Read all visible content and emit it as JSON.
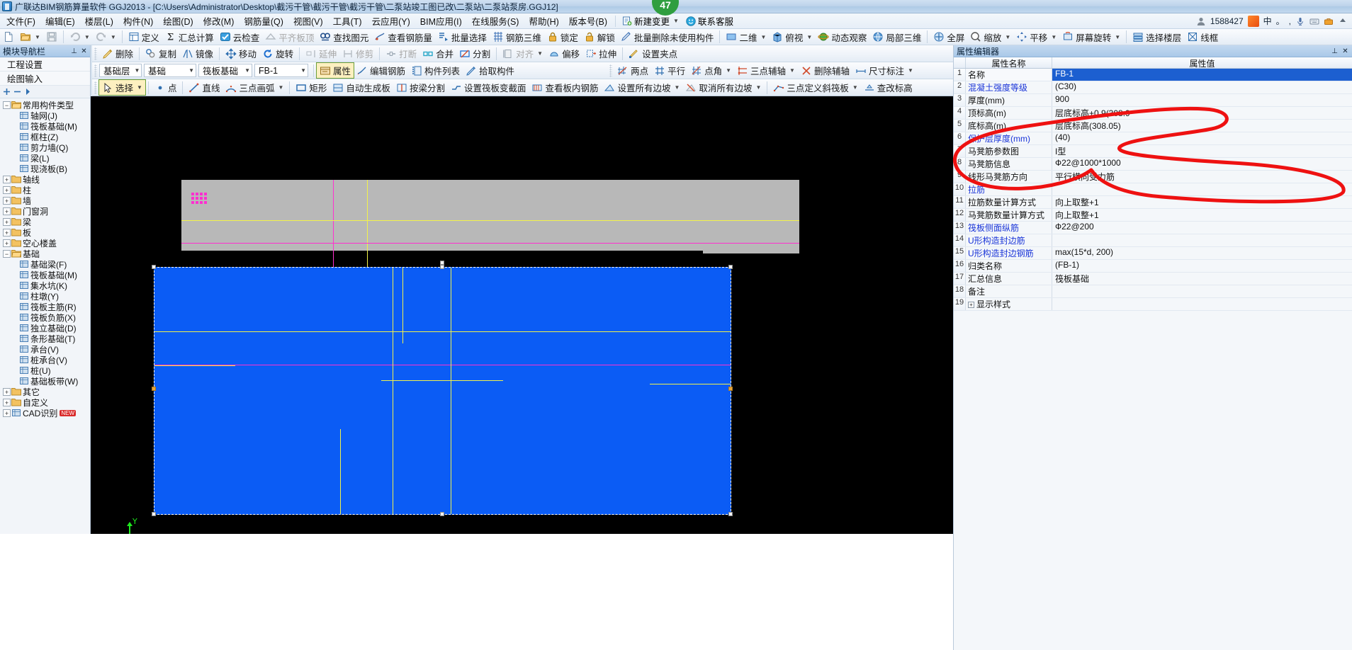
{
  "titlebar": {
    "title": "广联达BIM钢筋算量软件 GGJ2013 - [C:\\Users\\Administrator\\Desktop\\截污干管\\截污干管\\截污干管\\二泵站竣工图已改\\二泵站\\二泵站泵房.GGJ12]",
    "icon": "app-icon"
  },
  "menubar": {
    "items": [
      "文件(F)",
      "编辑(E)",
      "楼层(L)",
      "构件(N)",
      "绘图(D)",
      "修改(M)",
      "钢筋量(Q)",
      "视图(V)",
      "工具(T)",
      "云应用(Y)",
      "BIM应用(I)",
      "在线服务(S)",
      "帮助(H)",
      "版本号(B)"
    ],
    "new_change": "新建变更",
    "contact": "联系客服",
    "account": "1588427",
    "ime_items": [
      "中",
      "。",
      ",",
      "mic",
      "keyboard",
      "tool"
    ]
  },
  "toolbar1": {
    "items": [
      {
        "label": "",
        "icon": "new-file-icon",
        "disabled": false
      },
      {
        "label": "",
        "icon": "open-folder-icon",
        "disabled": false,
        "caret": true
      },
      {
        "label": "",
        "icon": "save-icon",
        "disabled": true
      },
      {
        "label": "",
        "icon": "undo-icon",
        "disabled": true,
        "caret": true
      },
      {
        "label": "",
        "icon": "redo-icon",
        "disabled": true,
        "caret": true
      },
      {
        "label": "定义",
        "icon": "define-icon"
      },
      {
        "label": "汇总计算",
        "icon": "sigma-icon"
      },
      {
        "label": "云检查",
        "icon": "cloud-check-icon"
      },
      {
        "label": "平齐板顶",
        "icon": "align-slab-top-icon",
        "disabled": true
      },
      {
        "label": "查找图元",
        "icon": "find-element-icon"
      },
      {
        "label": "查看钢筋量",
        "icon": "view-rebar-qty-icon"
      },
      {
        "label": "批量选择",
        "icon": "batch-select-icon"
      },
      {
        "label": "钢筋三维",
        "icon": "rebar-3d-icon"
      },
      {
        "label": "锁定",
        "icon": "lock-icon"
      },
      {
        "label": "解锁",
        "icon": "unlock-icon"
      },
      {
        "label": "批量删除未使用构件",
        "icon": "batch-delete-icon"
      },
      {
        "label": "二维",
        "icon": "view-2d-icon",
        "caret": true
      },
      {
        "label": "俯视",
        "icon": "top-view-icon",
        "caret": true
      },
      {
        "label": "动态观察",
        "icon": "orbit-icon"
      },
      {
        "label": "局部三维",
        "icon": "partial-3d-icon"
      },
      {
        "label": "全屏",
        "icon": "fullscreen-icon"
      },
      {
        "label": "缩放",
        "icon": "zoom-icon",
        "caret": true
      },
      {
        "label": "平移",
        "icon": "pan-icon",
        "caret": true
      },
      {
        "label": "屏幕旋转",
        "icon": "screen-rotate-icon",
        "caret": true
      },
      {
        "label": "选择楼层",
        "icon": "select-floor-icon"
      },
      {
        "label": "线框",
        "icon": "wireframe-icon"
      }
    ]
  },
  "toolbar2": {
    "items": [
      {
        "label": "删除",
        "icon": "delete-icon"
      },
      {
        "label": "复制",
        "icon": "copy-icon"
      },
      {
        "label": "镜像",
        "icon": "mirror-icon"
      },
      {
        "label": "移动",
        "icon": "move-icon"
      },
      {
        "label": "旋转",
        "icon": "rotate-icon"
      },
      {
        "label": "延伸",
        "icon": "extend-icon",
        "disabled": true
      },
      {
        "label": "修剪",
        "icon": "trim-icon",
        "disabled": true
      },
      {
        "label": "打断",
        "icon": "break-icon",
        "disabled": true
      },
      {
        "label": "合并",
        "icon": "merge-icon"
      },
      {
        "label": "分割",
        "icon": "split-icon"
      },
      {
        "label": "对齐",
        "icon": "align-icon",
        "disabled": true,
        "caret": true
      },
      {
        "label": "偏移",
        "icon": "offset-icon"
      },
      {
        "label": "拉伸",
        "icon": "stretch-icon"
      },
      {
        "label": "设置夹点",
        "icon": "set-grip-icon"
      }
    ]
  },
  "toolbar3": {
    "combos": [
      {
        "name": "floor",
        "value": "基础层"
      },
      {
        "name": "category",
        "value": "基础"
      },
      {
        "name": "component-type",
        "value": "筏板基础"
      },
      {
        "name": "component-name",
        "value": "FB-1"
      }
    ],
    "buttons": [
      {
        "label": "属性",
        "icon": "properties-icon",
        "active": true
      },
      {
        "label": "编辑钢筋",
        "icon": "edit-rebar-icon"
      },
      {
        "label": "构件列表",
        "icon": "component-list-icon"
      },
      {
        "label": "拾取构件",
        "icon": "pick-component-icon"
      }
    ],
    "axis_buttons": [
      {
        "label": "两点",
        "icon": "two-point-icon"
      },
      {
        "label": "平行",
        "icon": "parallel-icon"
      },
      {
        "label": "点角",
        "icon": "point-angle-icon",
        "caret": true
      },
      {
        "label": "三点辅轴",
        "icon": "three-point-axis-icon",
        "caret": true
      },
      {
        "label": "删除辅轴",
        "icon": "delete-axis-icon"
      },
      {
        "label": "尺寸标注",
        "icon": "dimension-icon",
        "caret": true
      }
    ]
  },
  "toolbar4": {
    "items": [
      {
        "label": "选择",
        "icon": "select-arrow-icon",
        "active": true,
        "caret": true
      },
      {
        "label": "点",
        "icon": "point-icon"
      },
      {
        "label": "直线",
        "icon": "line-icon"
      },
      {
        "label": "三点画弧",
        "icon": "three-point-arc-icon",
        "caret": true
      },
      {
        "label": "矩形",
        "icon": "rectangle-icon"
      },
      {
        "label": "自动生成板",
        "icon": "auto-gen-slab-icon"
      },
      {
        "label": "按梁分割",
        "icon": "split-by-beam-icon"
      },
      {
        "label": "设置筏板变截面",
        "icon": "set-raft-section-icon"
      },
      {
        "label": "查看板内钢筋",
        "icon": "view-slab-rebar-icon"
      },
      {
        "label": "设置所有边坡",
        "icon": "set-all-slope-icon",
        "caret": true
      },
      {
        "label": "取消所有边坡",
        "icon": "cancel-all-slope-icon",
        "caret": true
      },
      {
        "label": "三点定义斜筏板",
        "icon": "three-point-slope-raft-icon",
        "caret": true
      },
      {
        "label": "查改标高",
        "icon": "check-elevation-icon"
      }
    ]
  },
  "leftpanel": {
    "title": "模块导航栏",
    "buttons": [
      "工程设置",
      "绘图输入"
    ],
    "tree": [
      {
        "level": 0,
        "label": "常用构件类型",
        "icon": "folder-open-icon",
        "expander": "minus"
      },
      {
        "level": 1,
        "label": "轴网(J)",
        "icon": "grid-icon",
        "expander": ""
      },
      {
        "level": 1,
        "label": "筏板基础(M)",
        "icon": "raft-icon",
        "expander": ""
      },
      {
        "level": 1,
        "label": "框柱(Z)",
        "icon": "column-icon",
        "expander": ""
      },
      {
        "level": 1,
        "label": "剪力墙(Q)",
        "icon": "wall-icon",
        "expander": ""
      },
      {
        "level": 1,
        "label": "梁(L)",
        "icon": "beam-icon",
        "expander": ""
      },
      {
        "level": 1,
        "label": "现浇板(B)",
        "icon": "slab-icon",
        "expander": ""
      },
      {
        "level": 0,
        "label": "轴线",
        "icon": "folder-icon",
        "expander": "plus"
      },
      {
        "level": 0,
        "label": "柱",
        "icon": "folder-icon",
        "expander": "plus"
      },
      {
        "level": 0,
        "label": "墙",
        "icon": "folder-icon",
        "expander": "plus"
      },
      {
        "level": 0,
        "label": "门窗洞",
        "icon": "folder-icon",
        "expander": "plus"
      },
      {
        "level": 0,
        "label": "梁",
        "icon": "folder-icon",
        "expander": "plus"
      },
      {
        "level": 0,
        "label": "板",
        "icon": "folder-icon",
        "expander": "plus"
      },
      {
        "level": 0,
        "label": "空心楼盖",
        "icon": "folder-icon",
        "expander": "plus"
      },
      {
        "level": 0,
        "label": "基础",
        "icon": "folder-open-icon",
        "expander": "minus"
      },
      {
        "level": 1,
        "label": "基础梁(F)",
        "icon": "found-beam-icon",
        "expander": ""
      },
      {
        "level": 1,
        "label": "筏板基础(M)",
        "icon": "raft-icon",
        "expander": ""
      },
      {
        "level": 1,
        "label": "集水坑(K)",
        "icon": "pit-icon",
        "expander": ""
      },
      {
        "level": 1,
        "label": "柱墩(Y)",
        "icon": "pier-icon",
        "expander": ""
      },
      {
        "level": 1,
        "label": "筏板主筋(R)",
        "icon": "main-rebar-icon",
        "expander": ""
      },
      {
        "level": 1,
        "label": "筏板负筋(X)",
        "icon": "neg-rebar-icon",
        "expander": ""
      },
      {
        "level": 1,
        "label": "独立基础(D)",
        "icon": "indep-found-icon",
        "expander": ""
      },
      {
        "level": 1,
        "label": "条形基础(T)",
        "icon": "strip-found-icon",
        "expander": ""
      },
      {
        "level": 1,
        "label": "承台(V)",
        "icon": "cap-icon",
        "expander": ""
      },
      {
        "level": 1,
        "label": "桩承台(V)",
        "icon": "pile-cap-icon",
        "expander": ""
      },
      {
        "level": 1,
        "label": "桩(U)",
        "icon": "pile-icon",
        "expander": ""
      },
      {
        "level": 1,
        "label": "基础板带(W)",
        "icon": "found-band-icon",
        "expander": ""
      },
      {
        "level": 0,
        "label": "其它",
        "icon": "folder-icon",
        "expander": "plus"
      },
      {
        "level": 0,
        "label": "自定义",
        "icon": "folder-icon",
        "expander": "plus"
      },
      {
        "level": 0,
        "label": "CAD识别",
        "icon": "cad-icon",
        "expander": "plus",
        "badge": "NEW"
      }
    ]
  },
  "properties": {
    "title": "属性编辑器",
    "columns": [
      "属性名称",
      "属性值"
    ],
    "rows": [
      {
        "n": "1",
        "name": "名称",
        "value": "FB-1",
        "blue": false,
        "selected": true
      },
      {
        "n": "2",
        "name": "混凝土强度等级",
        "value": "(C30)",
        "blue": true
      },
      {
        "n": "3",
        "name": "厚度(mm)",
        "value": "900",
        "blue": false
      },
      {
        "n": "4",
        "name": "顶标高(m)",
        "value": "层底标高+0.9(308.9",
        "blue": false
      },
      {
        "n": "5",
        "name": "底标高(m)",
        "value": "层底标高(308.05)",
        "blue": false
      },
      {
        "n": "6",
        "name": "保护层厚度(mm)",
        "value": "(40)",
        "blue": true
      },
      {
        "n": "7",
        "name": "马凳筋参数图",
        "value": "I型",
        "blue": false
      },
      {
        "n": "8",
        "name": "马凳筋信息",
        "value": "Ф22@1000*1000",
        "blue": false
      },
      {
        "n": "9",
        "name": "线形马凳筋方向",
        "value": "平行横向受力筋",
        "blue": false
      },
      {
        "n": "10",
        "name": "拉筋",
        "value": "",
        "blue": true
      },
      {
        "n": "11",
        "name": "拉筋数量计算方式",
        "value": "向上取整+1",
        "blue": false
      },
      {
        "n": "12",
        "name": "马凳筋数量计算方式",
        "value": "向上取整+1",
        "blue": false
      },
      {
        "n": "13",
        "name": "筏板侧面纵筋",
        "value": "Ф22@200",
        "blue": true
      },
      {
        "n": "14",
        "name": "U形构造封边筋",
        "value": "",
        "blue": true
      },
      {
        "n": "15",
        "name": "U形构造封边钢筋",
        "value": "max(15*d, 200)",
        "blue": true
      },
      {
        "n": "16",
        "name": "归类名称",
        "value": "(FB-1)",
        "blue": false
      },
      {
        "n": "17",
        "name": "汇总信息",
        "value": "筏板基础",
        "blue": false
      },
      {
        "n": "18",
        "name": "备注",
        "value": "",
        "blue": false
      },
      {
        "n": "19",
        "name": "显示样式",
        "value": "",
        "blue": false,
        "expandable": true
      }
    ]
  },
  "canvas": {
    "selected_component": "FB-1",
    "axis_label": "Y",
    "badge_count": "47"
  },
  "colors": {
    "selection_blue": "#0b5cf5",
    "slab_gray": "#b8b8b8",
    "rebar_yellow": "#f2f24a",
    "rebar_magenta": "#ff2fd0",
    "annotation_red": "#ee1111",
    "accent": "#1c5fd0"
  }
}
